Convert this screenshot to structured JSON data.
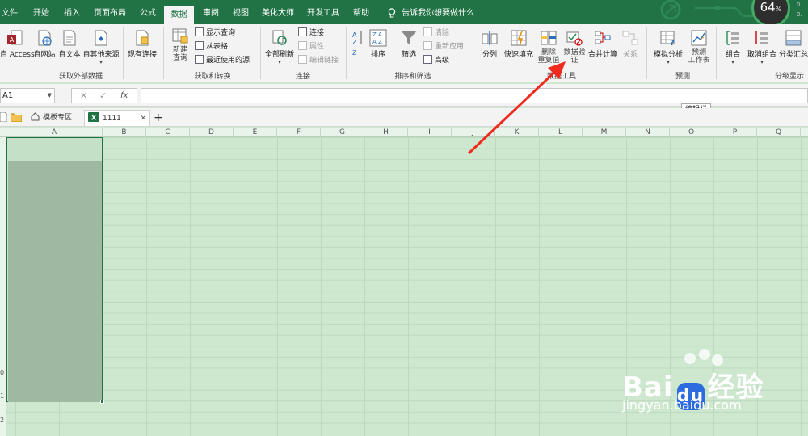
{
  "tabs": [
    {
      "label": "文件",
      "active": false
    },
    {
      "label": "开始",
      "active": false
    },
    {
      "label": "插入",
      "active": false
    },
    {
      "label": "页面布局",
      "active": false
    },
    {
      "label": "公式",
      "active": false
    },
    {
      "label": "数据",
      "active": true
    },
    {
      "label": "审阅",
      "active": false
    },
    {
      "label": "视图",
      "active": false
    },
    {
      "label": "美化大师",
      "active": false
    },
    {
      "label": "开发工具",
      "active": false
    },
    {
      "label": "帮助",
      "active": false
    }
  ],
  "tell_me": "告诉我你想要做什么",
  "status_badge": {
    "value": "64",
    "unit": "%",
    "side_1": "0.",
    "side_2": "0."
  },
  "ribbon": {
    "get_external": {
      "label": "获取外部数据",
      "access": "自 Access",
      "web": "自网站",
      "text": "自文本",
      "other": "自其他来源",
      "existing": "现有连接"
    },
    "get_transform": {
      "label": "获取和转换",
      "new_query_1": "新建",
      "new_query_2": "查询",
      "show_queries": "显示查询",
      "from_table": "从表格",
      "recent_sources": "最近使用的源"
    },
    "connections": {
      "label": "连接",
      "refresh_all": "全部刷新",
      "connections": "连接",
      "properties": "属性",
      "edit_links": "编辑链接"
    },
    "sort_filter": {
      "label": "排序和筛选",
      "sort": "排序",
      "filter": "筛选",
      "clear": "清除",
      "reapply": "重新应用",
      "advanced": "高级"
    },
    "data_tools": {
      "label": "数据工具",
      "text_to_columns": "分列",
      "flash_fill": "快速填充",
      "remove_dup_1": "删除",
      "remove_dup_2": "重复值",
      "validation_1": "数据验",
      "validation_2": "证",
      "consolidate": "合并计算",
      "relationships": "关系"
    },
    "forecast": {
      "label": "预测",
      "what_if": "模拟分析",
      "forecast_sheet_1": "预测",
      "forecast_sheet_2": "工作表"
    },
    "outline": {
      "label": "分级显示",
      "group": "组合",
      "ungroup": "取消组合",
      "subtotal": "分类汇总"
    }
  },
  "formula_bar": {
    "name_box": "A1",
    "fx": "fx",
    "tooltip": "编辑栏"
  },
  "doc_tabs": {
    "template_zone": "模板专区",
    "file_name": "1111",
    "close": "✕",
    "add": "+"
  },
  "columns": [
    "A",
    "B",
    "C",
    "D",
    "E",
    "F",
    "G",
    "H",
    "I",
    "J",
    "K",
    "L",
    "M",
    "N",
    "O",
    "P",
    "Q"
  ],
  "row_labels": [
    "0",
    "1",
    "2"
  ],
  "watermark": {
    "brand": "Bai",
    "brand_cn": "经验",
    "url": "jingyan.baidu.com"
  }
}
